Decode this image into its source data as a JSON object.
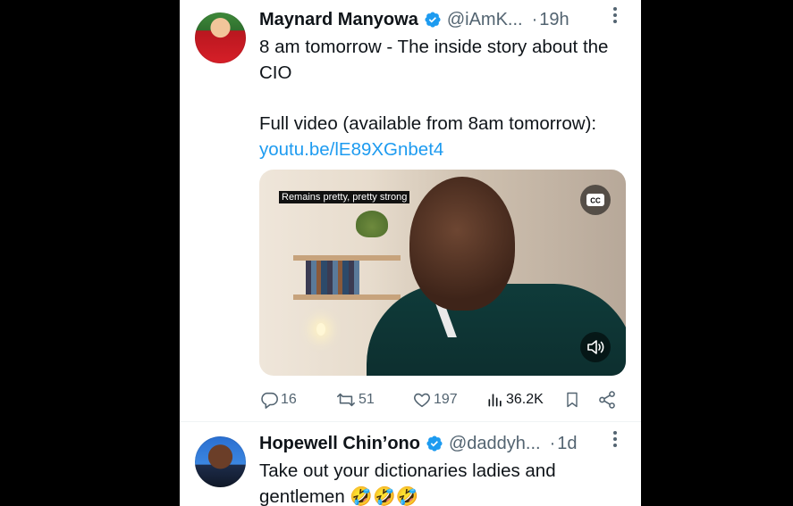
{
  "tweets": [
    {
      "author": "Maynard Manyowa",
      "handle": "@iAmK...",
      "separator": "·",
      "time": "19h",
      "text_line1": "8 am tomorrow - The inside story about the CIO",
      "text_line2": "Full video (available from 8am tomorrow):",
      "link": "youtu.be/lE89XGnbet4",
      "video": {
        "caption": "Remains pretty, pretty strong",
        "cc_icon": "cc-icon",
        "mute_icon": "speaker-icon"
      },
      "stats": {
        "replies": "16",
        "retweets": "51",
        "likes": "197",
        "views": "36.2K"
      }
    },
    {
      "author": "Hopewell Chin’ono",
      "handle": "@daddyh...",
      "separator": "·",
      "time": "1d",
      "text_line1": "Take out your dictionaries ladies and gentlemen 🤣🤣🤣"
    }
  ],
  "colors": {
    "link": "#1d9bf0",
    "verified": "#1d9bf0",
    "muted": "#536471"
  }
}
